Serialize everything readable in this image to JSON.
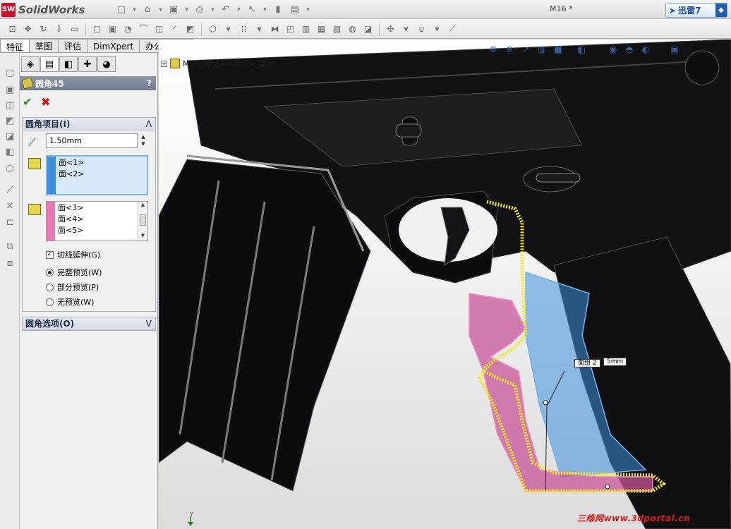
{
  "app": {
    "logo_mark": "SW",
    "logo_text": "SolidWorks",
    "document_title": "M16 *",
    "xunlei_label": "迅雷7"
  },
  "tabs": [
    {
      "label": "特征",
      "active": true
    },
    {
      "label": "草图",
      "active": false
    },
    {
      "label": "评估",
      "active": false
    },
    {
      "label": "DimXpert",
      "active": false
    },
    {
      "label": "办公室产品",
      "active": false
    }
  ],
  "property_manager": {
    "title": "圆角45",
    "help": "?",
    "ok": "✔",
    "cancel": "✖",
    "fillet_items": {
      "header": "圆角项目(I)",
      "radius_value": "1.50mm",
      "faces_set1": [
        "面<1>",
        "面<2>"
      ],
      "faces_set2": [
        "面<3>",
        "面<4>",
        "面<5>"
      ],
      "tangent_propagation": {
        "label": "切线延伸(G)",
        "checked": true
      },
      "preview_options": [
        {
          "label": "完整预览(W)",
          "selected": true
        },
        {
          "label": "部分预览(P)",
          "selected": false
        },
        {
          "label": "无预览(W)",
          "selected": false
        }
      ]
    },
    "fillet_options": {
      "header": "圆角选项(O)"
    }
  },
  "viewport": {
    "tree_flyout": "M16 (默认<<默认>_显示...",
    "callout_text": "5mm",
    "callout_label": "面组 2",
    "triad_label": "Y",
    "watermark": "三维网www.3dportal.cn"
  },
  "colors": {
    "face_set1": "#3e8fdc",
    "face_set2": "#e879b4",
    "fillet_highlight": "#f5e626",
    "model": "#1a1a1c"
  }
}
